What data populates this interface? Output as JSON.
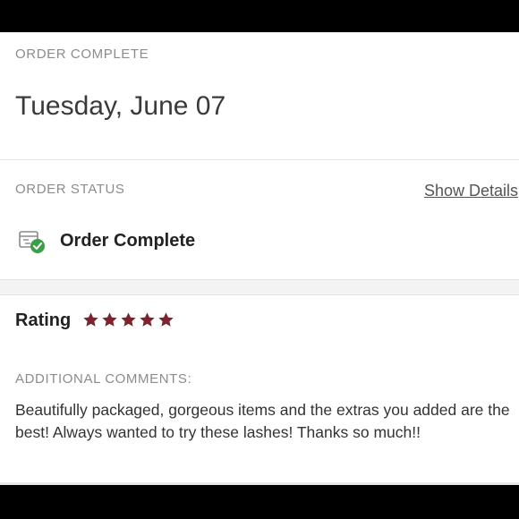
{
  "order": {
    "section_label": "ORDER COMPLETE",
    "date": "Tuesday, June 07"
  },
  "status": {
    "section_label": "ORDER STATUS",
    "show_details_link": "Show Details",
    "status_text": "Order Complete",
    "icon": "box-check-icon",
    "check_color": "#3aa048"
  },
  "rating": {
    "label": "Rating",
    "stars": 5,
    "max_stars": 5,
    "star_color": "#7b2430"
  },
  "comments": {
    "section_label": "ADDITIONAL COMMENTS:",
    "text": "Beautifully packaged, gorgeous items and the extras you added are the best! Always wanted to try these lashes! Thanks so much!!"
  }
}
